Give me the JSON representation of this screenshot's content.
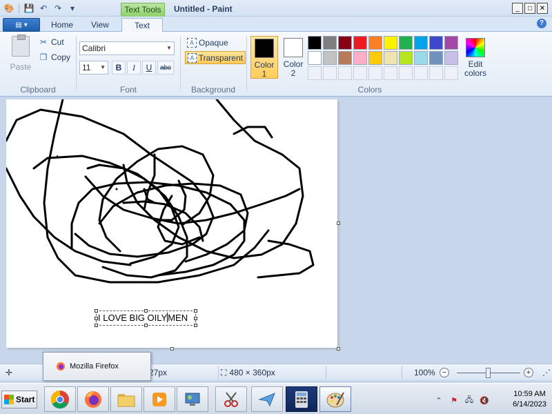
{
  "window": {
    "title": "Untitled - Paint",
    "contextual_tab": "Text Tools"
  },
  "tabs": [
    {
      "label": "Home"
    },
    {
      "label": "View"
    },
    {
      "label": "Text",
      "active": true
    }
  ],
  "ribbon": {
    "clipboard": {
      "group": "Clipboard",
      "paste": "Paste",
      "cut": "Cut",
      "copy": "Copy"
    },
    "font": {
      "group": "Font",
      "family": "Calibri",
      "size": "11",
      "bold": "B",
      "italic": "I",
      "underline": "U",
      "strike": "abc"
    },
    "background": {
      "group": "Background",
      "opaque": "Opaque",
      "transparent": "Transparent",
      "selected": "transparent"
    },
    "colors": {
      "group": "Colors",
      "color1_label": "Color",
      "color1_num": "1",
      "color2_label": "Color",
      "color2_num": "2",
      "color1": "#000000",
      "color2": "#ffffff",
      "edit_label_1": "Edit",
      "edit_label_2": "colors",
      "palette_row1": [
        "#000000",
        "#7f7f7f",
        "#880015",
        "#ed1c24",
        "#ff7f27",
        "#fff200",
        "#22b14c",
        "#00a2e8",
        "#3f48cc",
        "#a349a4"
      ],
      "palette_row2": [
        "#ffffff",
        "#c3c3c3",
        "#b97a57",
        "#ffaec9",
        "#ffc90e",
        "#efe4b0",
        "#b5e61d",
        "#99d9ea",
        "#7092be",
        "#c8bfe7"
      ],
      "palette_row3_empty": 10
    }
  },
  "canvas": {
    "text": "I LOVE BIG OILY",
    "text_after_caret": "MEN"
  },
  "statusbar": {
    "cursor_pos": "27px",
    "canvas_size": "480 × 360px",
    "zoom": "100%",
    "zoom_level": 0.5
  },
  "popup": {
    "label": "Mozilla Firefox"
  },
  "taskbar": {
    "start": "Start",
    "apps": [
      "chrome-icon",
      "firefox-icon",
      "explorer-icon",
      "media-player-icon",
      "control-panel-icon",
      "snipping-tool-icon",
      "paper-plane-icon",
      "calculator-icon",
      "paint-icon"
    ],
    "time": "10:59 AM",
    "date": "6/14/2023"
  }
}
